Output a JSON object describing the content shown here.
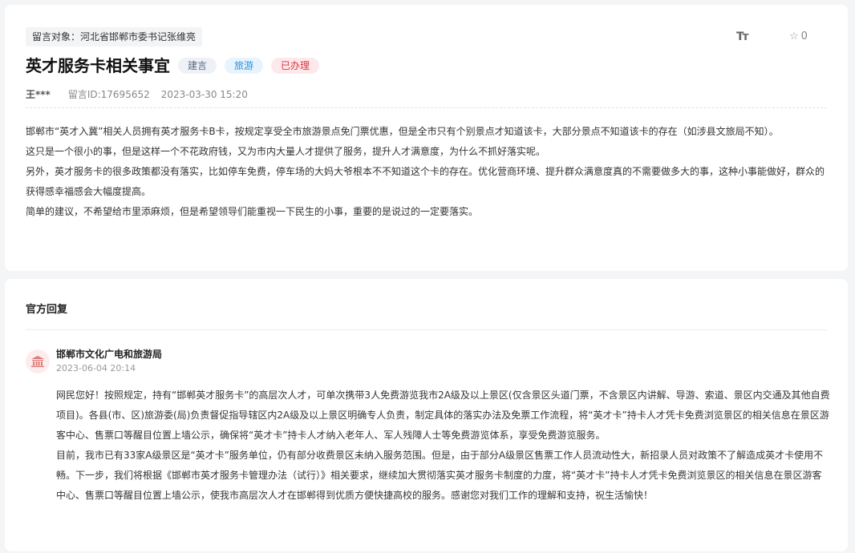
{
  "message": {
    "target": "留言对象：河北省邯郸市委书记张维亮",
    "toolbar": {
      "font_icon": "Tт",
      "favorite_count": "0"
    },
    "title": "英才服务卡相关事宜",
    "tags": [
      "建言",
      "旅游",
      "已办理"
    ],
    "author": "王***",
    "id_label": "留言ID:17695652",
    "datetime": "2023-03-30 15:20",
    "paragraphs": [
      "邯郸市“英才入冀”相关人员拥有英才服务卡B卡，按规定享受全市旅游景点免门票优惠，但是全市只有个别景点才知道该卡，大部分景点不知道该卡的存在（如涉县文旅局不知）。",
      "这只是一个很小的事，但是这样一个不花政府钱，又为市内大量人才提供了服务，提升人才满意度，为什么不抓好落实呢。",
      "另外，英才服务卡的很多政策都没有落实，比如停车免费，停车场的大妈大爷根本不不知道这个卡的存在。优化营商环境、提升群众满意度真的不需要做多大的事，这种小事能做好，群众的获得感幸福感会大幅度提高。",
      "简单的建议，不希望给市里添麻烦，但是希望领导们能重视一下民生的小事，重要的是说过的一定要落实。"
    ]
  },
  "reply": {
    "heading": "官方回复",
    "org_name": "邯郸市文化广电和旅游局",
    "datetime": "2023-06-04 20:14",
    "paragraphs": [
      "网民您好！按照规定，持有“邯郸英才服务卡”的高层次人才，可单次携带3人免费游览我市2A级及以上景区(仅含景区头道门票，不含景区内讲解、导游、索道、景区内交通及其他自费项目)。各县(市、区)旅游委(局)负责督促指导辖区内2A级及以上景区明确专人负责，制定具体的落实办法及免票工作流程，将“英才卡”持卡人才凭卡免费浏览景区的相关信息在景区游客中心、售票口等醒目位置上墙公示，确保将“英才卡”持卡人才纳入老年人、军人残障人士等免费游览体系，享受免费游览服务。",
      "目前，我市已有33家A级景区是“英才卡”服务单位，仍有部分收费景区未纳入服务范围。但是，由于部分A级景区售票工作人员流动性大，新招录人员对政策不了解造成英才卡使用不畅。下一步，我们将根据《邯郸市英才服务卡管理办法（试行）》相关要求，继续加大贯彻落实英才服务卡制度的力度，将“英才卡”持卡人才凭卡免费浏览景区的相关信息在景区游客中心、售票口等醒目位置上墙公示，使我市高层次人才在邯郸得到优质方便快捷高校的服务。感谢您对我们工作的理解和支持，祝生活愉快！"
    ]
  },
  "colors": {
    "tag_red": "#d9363e",
    "tag_cyan": "#2e8fd8",
    "tag_blue": "#5b6a86",
    "avatar_bg": "#fdecec"
  }
}
